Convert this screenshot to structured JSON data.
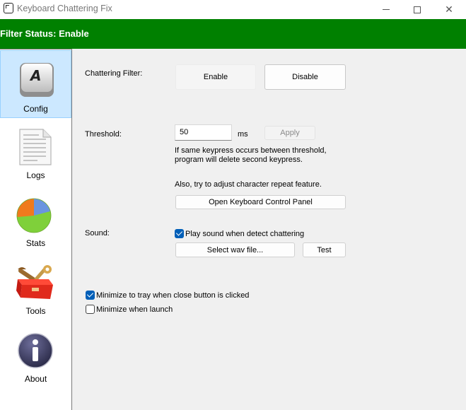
{
  "window": {
    "title": "Keyboard Chattering Fix",
    "close_glyph": "✕"
  },
  "status": {
    "text": "Filter Status: Enable",
    "color": "#008000"
  },
  "sidebar": {
    "items": [
      {
        "label": "Config",
        "icon": "keyboard-key-icon",
        "selected": true
      },
      {
        "label": "Logs",
        "icon": "document-icon",
        "selected": false
      },
      {
        "label": "Stats",
        "icon": "pie-chart-icon",
        "selected": false
      },
      {
        "label": "Tools",
        "icon": "toolbox-icon",
        "selected": false
      },
      {
        "label": "About",
        "icon": "info-icon",
        "selected": false
      }
    ],
    "config_key_letter": "A"
  },
  "config": {
    "chattering_filter_label": "Chattering Filter:",
    "enable_button": "Enable",
    "disable_button": "Disable",
    "threshold_label": "Threshold:",
    "threshold_value": "50",
    "threshold_unit": "ms",
    "apply_button": "Apply",
    "threshold_help_1": "If same keypress occurs between threshold,",
    "threshold_help_2": "program will delete second keypress.",
    "repeat_hint": "Also, try to adjust character repeat feature.",
    "open_keyboard_button": "Open Keyboard Control Panel",
    "sound_label": "Sound:",
    "play_sound_label": "Play sound when detect chattering",
    "play_sound_checked": true,
    "select_wav_button": "Select wav file...",
    "test_button": "Test",
    "minimize_tray_label": "Minimize to tray when close button is clicked",
    "minimize_tray_checked": true,
    "minimize_launch_label": "Minimize when launch",
    "minimize_launch_checked": false
  }
}
